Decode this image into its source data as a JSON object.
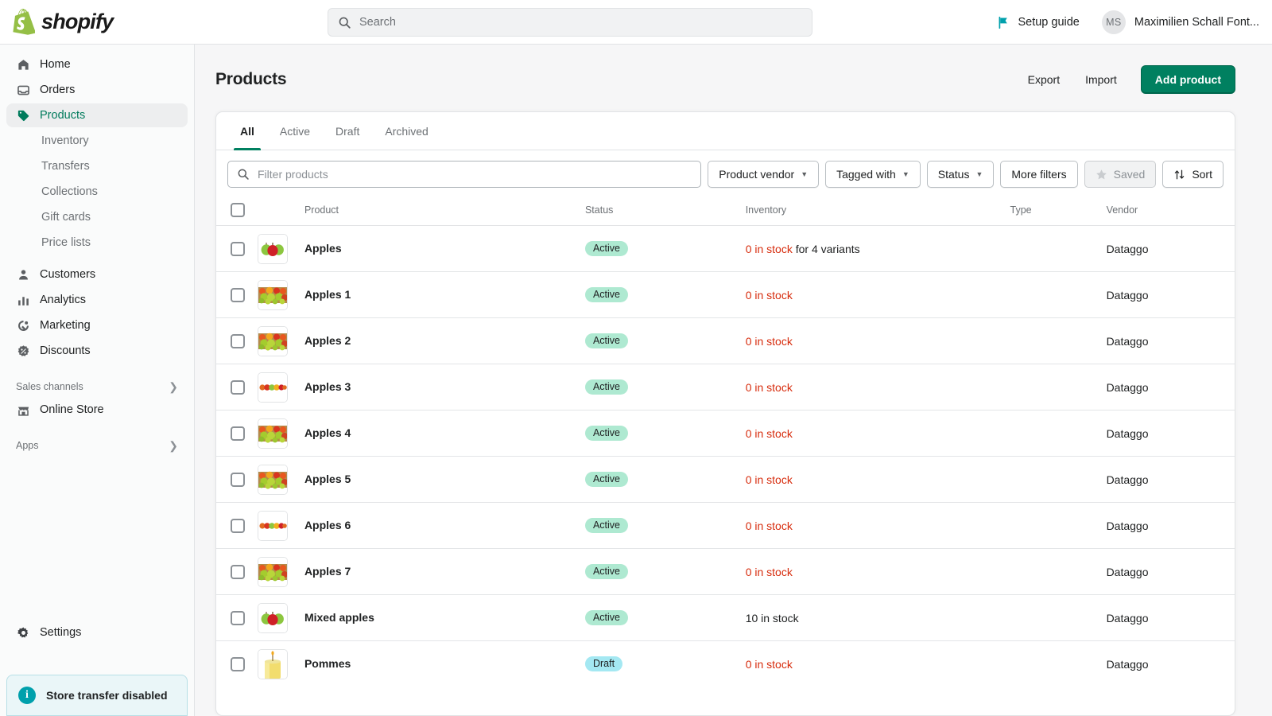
{
  "topbar": {
    "logo_text": "shopify",
    "search_placeholder": "Search",
    "search_icon": "search-icon",
    "setup_guide_label": "Setup guide",
    "setup_guide_icon": "flag-icon",
    "user_initials": "MS",
    "user_name": "Maximilien Schall Font..."
  },
  "sidebar": {
    "items": [
      {
        "label": "Home",
        "icon": "home-icon",
        "active": false
      },
      {
        "label": "Orders",
        "icon": "orders-icon",
        "active": false
      },
      {
        "label": "Products",
        "icon": "tag-icon",
        "active": true
      },
      {
        "label": "Customers",
        "icon": "person-icon",
        "active": false
      },
      {
        "label": "Analytics",
        "icon": "bars-icon",
        "active": false
      },
      {
        "label": "Marketing",
        "icon": "megaphone-icon",
        "active": false
      },
      {
        "label": "Discounts",
        "icon": "discount-icon",
        "active": false
      }
    ],
    "sub_items": [
      {
        "label": "Inventory"
      },
      {
        "label": "Transfers"
      },
      {
        "label": "Collections"
      },
      {
        "label": "Gift cards"
      },
      {
        "label": "Price lists"
      }
    ],
    "sales_channels_label": "Sales channels",
    "online_store_label": "Online Store",
    "online_store_icon": "store-icon",
    "apps_label": "Apps",
    "settings_label": "Settings",
    "settings_icon": "gear-icon",
    "banner": {
      "text": "Store transfer disabled",
      "icon": "info-icon",
      "accent": "#00a0ac",
      "background": "#eaf6f8"
    }
  },
  "page": {
    "title": "Products",
    "export_label": "Export",
    "import_label": "Import",
    "add_product_label": "Add product",
    "primary_color": "#008060"
  },
  "tabs": [
    {
      "label": "All",
      "active": true
    },
    {
      "label": "Active",
      "active": false
    },
    {
      "label": "Draft",
      "active": false
    },
    {
      "label": "Archived",
      "active": false
    }
  ],
  "filters": {
    "search_placeholder": "Filter products",
    "search_icon": "search-icon",
    "buttons": [
      {
        "label": "Product vendor",
        "caret": true,
        "disabled": false
      },
      {
        "label": "Tagged with",
        "caret": true,
        "disabled": false
      },
      {
        "label": "Status",
        "caret": true,
        "disabled": false
      },
      {
        "label": "More filters",
        "caret": false,
        "disabled": false
      }
    ],
    "saved_label": "Saved",
    "saved_icon": "star-icon",
    "saved_disabled": true,
    "sort_label": "Sort",
    "sort_icon": "sort-arrows-icon"
  },
  "table": {
    "columns": [
      "Product",
      "Status",
      "Inventory",
      "Type",
      "Vendor"
    ],
    "rows": [
      {
        "name": "Apples",
        "thumb": "apples-trio",
        "status": "Active",
        "status_kind": "active",
        "inventory_count": "0 in stock",
        "inventory_zero": true,
        "inventory_suffix": " for 4 variants",
        "type": "",
        "vendor": "Dataggo"
      },
      {
        "name": "Apples 1",
        "thumb": "fruit-basket",
        "status": "Active",
        "status_kind": "active",
        "inventory_count": "0 in stock",
        "inventory_zero": true,
        "inventory_suffix": "",
        "type": "",
        "vendor": "Dataggo"
      },
      {
        "name": "Apples 2",
        "thumb": "fruit-basket",
        "status": "Active",
        "status_kind": "active",
        "inventory_count": "0 in stock",
        "inventory_zero": true,
        "inventory_suffix": "",
        "type": "",
        "vendor": "Dataggo"
      },
      {
        "name": "Apples 3",
        "thumb": "apple-row",
        "status": "Active",
        "status_kind": "active",
        "inventory_count": "0 in stock",
        "inventory_zero": true,
        "inventory_suffix": "",
        "type": "",
        "vendor": "Dataggo"
      },
      {
        "name": "Apples 4",
        "thumb": "fruit-basket",
        "status": "Active",
        "status_kind": "active",
        "inventory_count": "0 in stock",
        "inventory_zero": true,
        "inventory_suffix": "",
        "type": "",
        "vendor": "Dataggo"
      },
      {
        "name": "Apples 5",
        "thumb": "fruit-basket",
        "status": "Active",
        "status_kind": "active",
        "inventory_count": "0 in stock",
        "inventory_zero": true,
        "inventory_suffix": "",
        "type": "",
        "vendor": "Dataggo"
      },
      {
        "name": "Apples 6",
        "thumb": "apple-row",
        "status": "Active",
        "status_kind": "active",
        "inventory_count": "0 in stock",
        "inventory_zero": true,
        "inventory_suffix": "",
        "type": "",
        "vendor": "Dataggo"
      },
      {
        "name": "Apples 7",
        "thumb": "fruit-basket",
        "status": "Active",
        "status_kind": "active",
        "inventory_count": "0 in stock",
        "inventory_zero": true,
        "inventory_suffix": "",
        "type": "",
        "vendor": "Dataggo"
      },
      {
        "name": "Mixed apples",
        "thumb": "apples-trio",
        "status": "Active",
        "status_kind": "active",
        "inventory_count": "10 in stock",
        "inventory_zero": false,
        "inventory_suffix": "",
        "type": "",
        "vendor": "Dataggo"
      },
      {
        "name": "Pommes",
        "thumb": "candle",
        "status": "Draft",
        "status_kind": "draft",
        "inventory_count": "0 in stock",
        "inventory_zero": true,
        "inventory_suffix": "",
        "type": "",
        "vendor": "Dataggo"
      }
    ]
  }
}
